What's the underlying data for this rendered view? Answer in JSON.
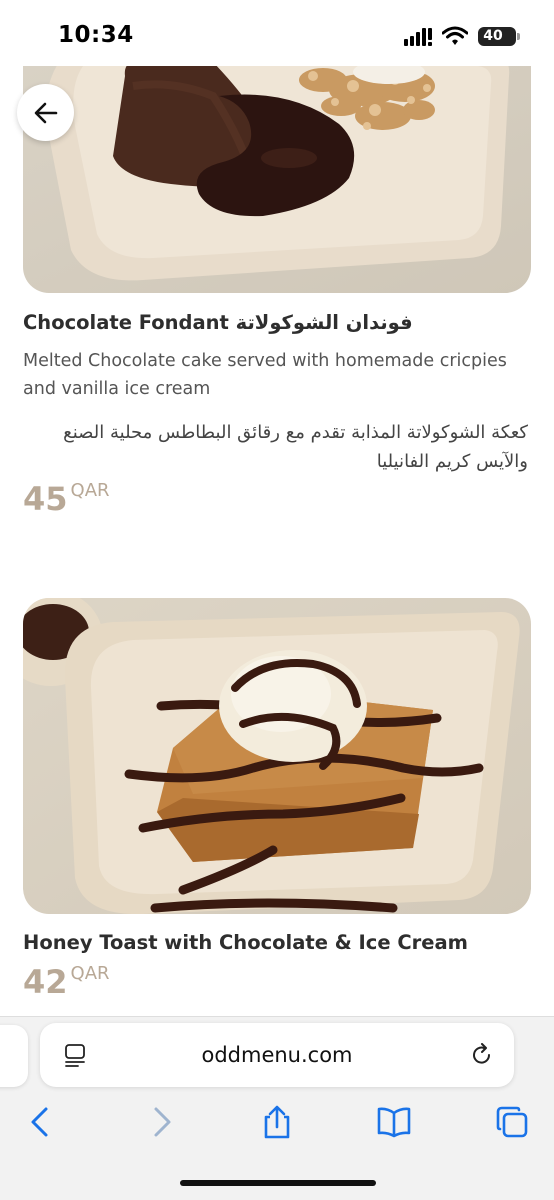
{
  "status_bar": {
    "time": "10:34",
    "battery": "40",
    "icons": [
      "signal-icon",
      "wifi-icon",
      "battery-icon"
    ]
  },
  "back": {
    "icon": "arrow-left-icon"
  },
  "dishes": [
    {
      "title": "Chocolate Fondant فوندان الشوكولاتة",
      "description_en": "Melted Chocolate cake served with homemade cricpies and vanilla ice cream",
      "description_ar": "كعكة الشوكولاتة المذابة تقدم مع رقائق البطاطس محلية الصنع والآيس كريم الفانيليا",
      "price": "45",
      "currency": "QAR"
    },
    {
      "title": "Honey Toast with Chocolate & Ice Cream",
      "price": "42",
      "currency": "QAR"
    }
  ],
  "browser": {
    "url": "oddmenu.com",
    "toolbar": [
      "back-icon",
      "forward-icon",
      "share-icon",
      "bookmarks-icon",
      "tabs-icon"
    ]
  },
  "colors": {
    "price": "#b8a896",
    "accent": "#1a73e8"
  }
}
